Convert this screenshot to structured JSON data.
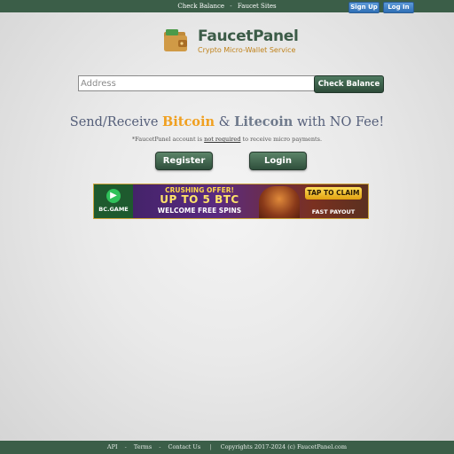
{
  "topnav": {
    "check_balance": "Check Balance",
    "separator": "-",
    "faucet_sites": "Faucet Sites",
    "signup_label": "Sign Up",
    "login_label": "Log In"
  },
  "logo": {
    "title": "FaucetPanel",
    "subtitle": "Crypto Micro-Wallet Service"
  },
  "search": {
    "placeholder": "Address",
    "value": "",
    "button_label": "Check Balance"
  },
  "hero": {
    "text_1": "Send/Receive ",
    "bitcoin": "Bitcoin",
    "text_2": " & ",
    "litecoin": "Litecoin",
    "text_3": " with NO Fee!",
    "note_1": "*FaucetPanel account is ",
    "note_underlined": "not required",
    "note_2": " to receive micro payments."
  },
  "actions": {
    "register_label": "Register",
    "login_label": "Login"
  },
  "banner": {
    "brand": "BC.GAME",
    "offer": "CRUSHING OFFER!",
    "headline": "UP TO 5 BTC",
    "spins": "WELCOME FREE SPINS",
    "claim": "TAP TO CLAIM",
    "payout": "FAST PAYOUT"
  },
  "footer": {
    "api": "API",
    "terms": "Terms",
    "contact": "Contact Us",
    "dot": "-",
    "divider": "|",
    "copyright": "Copyrights 2017-2024 (c) FaucetPanel.com"
  },
  "colors": {
    "brand_green": "#3b5e48",
    "bitcoin_orange": "#f0a020",
    "topbar_button_blue": "#3f7fc4"
  }
}
